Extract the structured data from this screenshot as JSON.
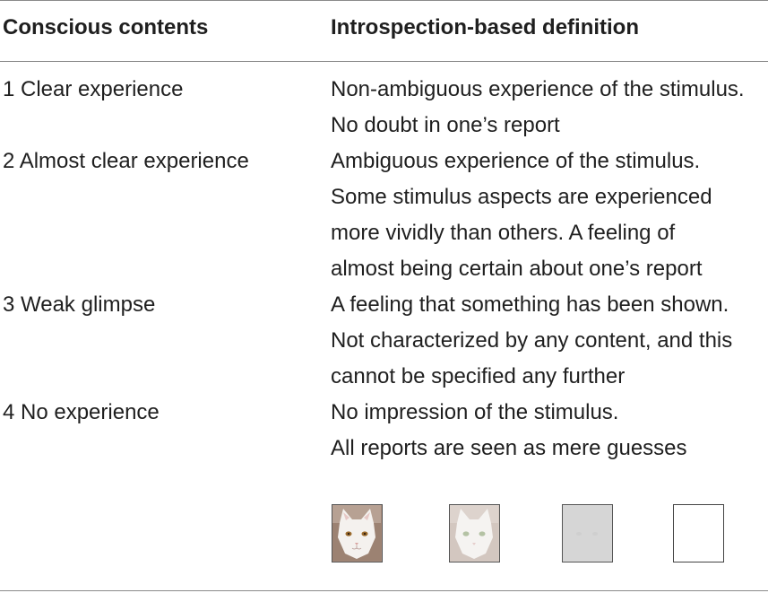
{
  "table": {
    "headers": {
      "contents": "Conscious contents",
      "definition": "Introspection-based definition"
    },
    "rows": [
      {
        "content": "1 Clear experience",
        "definition": [
          "Non-ambiguous experience of the stimulus.",
          "No doubt in one’s report"
        ]
      },
      {
        "content": "2 Almost clear experience",
        "definition": [
          "Ambiguous experience of the stimulus.",
          "Some stimulus aspects are experienced",
          "more vividly than others. A feeling of",
          "almost being certain about one’s report"
        ]
      },
      {
        "content": "3 Weak glimpse",
        "definition": [
          "A feeling that something has been shown.",
          "Not characterized by any content, and this",
          "cannot be specified any further"
        ]
      },
      {
        "content": "4 No experience",
        "definition": [
          "No impression of the stimulus.",
          "All reports are seen as mere guesses"
        ]
      }
    ]
  },
  "stimuli": [
    {
      "label": "cat-face-clear",
      "visibility": 1.0
    },
    {
      "label": "cat-face-faded",
      "visibility": 0.45
    },
    {
      "label": "cat-face-faint",
      "visibility": 0.08
    },
    {
      "label": "blank",
      "visibility": 0.0
    }
  ]
}
